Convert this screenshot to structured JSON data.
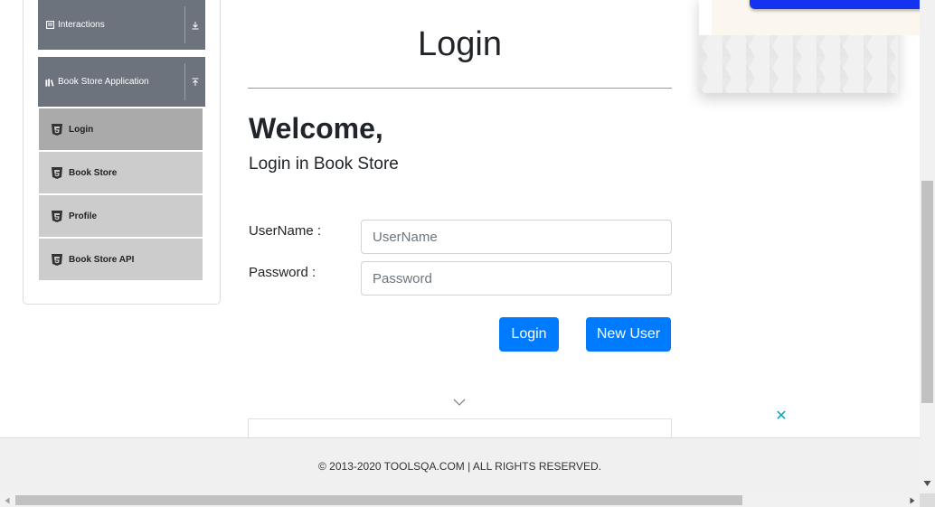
{
  "sidebar": {
    "groups": [
      {
        "label": "Interactions",
        "icon": "list-icon",
        "toggle": "download-arrow-icon"
      },
      {
        "label": "Book Store Application",
        "icon": "library-icon",
        "toggle": "upload-arrow-icon"
      }
    ],
    "items": [
      {
        "label": "Login",
        "icon": "html5-icon",
        "active": true
      },
      {
        "label": "Book Store",
        "icon": "html5-icon",
        "active": false
      },
      {
        "label": "Profile",
        "icon": "html5-icon",
        "active": false
      },
      {
        "label": "Book Store API",
        "icon": "html5-icon",
        "active": false
      }
    ]
  },
  "main": {
    "title": "Login",
    "welcome": "Welcome,",
    "subtitle": "Login in Book Store",
    "username_label": "UserName :",
    "username_placeholder": "UserName",
    "username_value": "",
    "password_label": "Password :",
    "password_placeholder": "Password",
    "password_value": "",
    "login_button": "Login",
    "new_user_button": "New User"
  },
  "ad": {
    "close_symbol": "✕"
  },
  "footer": {
    "text": "© 2013-2020 TOOLSQA.COM | ALL RIGHTS RESERVED."
  },
  "colors": {
    "primary": "#007bff",
    "sidebar_header": "#6c737d",
    "menu_item": "#cccccc",
    "menu_item_active": "#aaaaaa",
    "ad_close": "#0ea5c8"
  }
}
